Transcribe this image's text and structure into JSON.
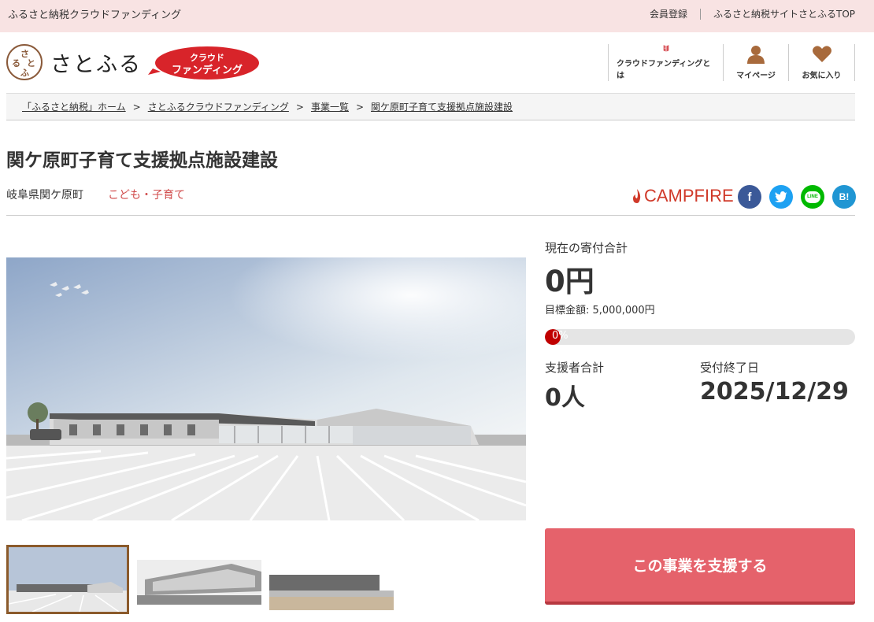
{
  "topbar": {
    "site_name": "ふるさと納税クラウドファンディング",
    "member_register": "会員登録",
    "satofull_top": "ふるさと納税サイトさとふるTOP"
  },
  "header": {
    "logo_text": "さとふる",
    "logo_mark_chars": [
      "さ",
      "と",
      "ふ",
      "る"
    ],
    "badge_line1": "クラウド",
    "badge_line2": "ファンディング",
    "nav": [
      {
        "label": "クラウドファンディングとは",
        "icon": "book-icon"
      },
      {
        "label": "マイページ",
        "icon": "user-icon"
      },
      {
        "label": "お気に入り",
        "icon": "heart-icon"
      }
    ]
  },
  "breadcrumb": [
    "「ふるさと納税」ホーム",
    "さとふるクラウドファンディング",
    "事業一覧",
    "関ケ原町子育て支援拠点施設建設"
  ],
  "breadcrumb_separator": ">",
  "project": {
    "title": "関ケ原町子育て支援拠点施設建設",
    "prefecture": "岐阜県関ケ原町",
    "category": "こども・子育て",
    "partner": "CAMPFIRE"
  },
  "share": {
    "facebook": "f",
    "twitter": "t",
    "line": "LINE",
    "hatena": "B!"
  },
  "stats": {
    "donation_label": "現在の寄付合計",
    "donation_amount": "0円",
    "target": "目標金額: 5,000,000円",
    "progress_text": "0%",
    "progress_value": 0,
    "supporters_label": "支援者合計",
    "supporters_value": "0人",
    "deadline_label": "受付終了日",
    "deadline_value": "2025/12/29"
  },
  "cta": {
    "support_label": "この事業を支援する"
  },
  "colors": {
    "topbar_bg": "#f8e3e3",
    "accent_red": "#e5626b",
    "category_red": "#d04a4a",
    "progress_fill": "#c00000",
    "brand_brown": "#8a5a3a"
  }
}
